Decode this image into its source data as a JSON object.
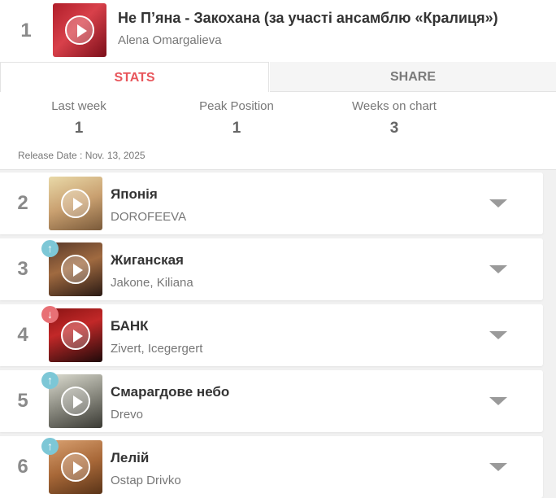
{
  "top_entry": {
    "rank": "1",
    "title": "Не П’яна - Закохана (за участі ансамблю «Кралиця»)",
    "artist": "Alena Omargalieva",
    "tabs": {
      "stats": "STATS",
      "share": "SHARE"
    },
    "stats": {
      "last_week_label": "Last week",
      "last_week_value": "1",
      "peak_label": "Peak Position",
      "peak_value": "1",
      "weeks_label": "Weeks on chart",
      "weeks_value": "3"
    },
    "release_date": "Release Date : Nov. 13, 2025"
  },
  "colors": {
    "accent": "#e8555b",
    "up": "#7dc7d6",
    "down": "#e87075"
  },
  "entries": [
    {
      "rank": "2",
      "title": "Японія",
      "artist": "DOROFEEVA",
      "trend": "none"
    },
    {
      "rank": "3",
      "title": "Жиганская",
      "artist": "Jakone,  Kiliana",
      "trend": "up"
    },
    {
      "rank": "4",
      "title": "БАНК",
      "artist": "Zivert,  Icegergert",
      "trend": "down"
    },
    {
      "rank": "5",
      "title": "Смарагдове небо",
      "artist": "Drevo",
      "trend": "up"
    },
    {
      "rank": "6",
      "title": "Лелій",
      "artist": "Ostap Drivko",
      "trend": "up"
    }
  ],
  "icons": {
    "play": "play-icon",
    "expand": "chevron-down-icon",
    "up": "arrow-up-icon",
    "down": "arrow-down-icon"
  }
}
